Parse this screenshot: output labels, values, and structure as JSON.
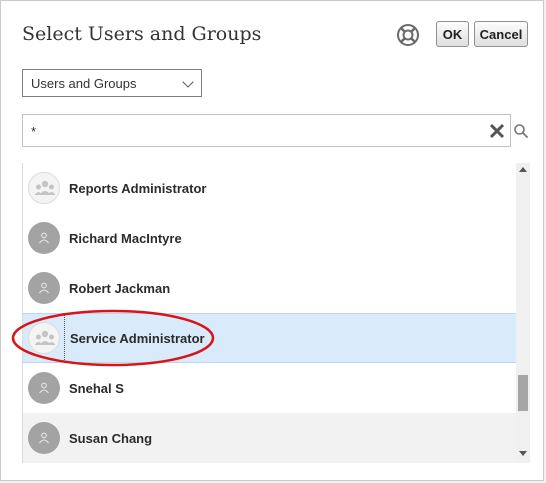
{
  "dialog": {
    "title": "Select Users and Groups",
    "help_icon": "lifebuoy-icon",
    "ok_label": "OK",
    "cancel_label": "Cancel"
  },
  "filter": {
    "selected": "Users and Groups",
    "icon": "chevron-down-icon"
  },
  "search": {
    "value": "*",
    "clear_icon": "clear-x-icon",
    "search_icon": "search-icon"
  },
  "list": {
    "items": [
      {
        "label": "Reports Administrator",
        "type": "group",
        "state": "normal"
      },
      {
        "label": "Richard MacIntyre",
        "type": "user",
        "state": "normal"
      },
      {
        "label": "Robert Jackman",
        "type": "user",
        "state": "normal"
      },
      {
        "label": "Service Administrator",
        "type": "group",
        "state": "selected"
      },
      {
        "label": "Snehal S",
        "type": "user",
        "state": "normal"
      },
      {
        "label": "Susan Chang",
        "type": "user",
        "state": "hover"
      }
    ]
  },
  "colors": {
    "selected_row": "#d9ebfb",
    "annotation_ellipse": "#d8141a"
  }
}
